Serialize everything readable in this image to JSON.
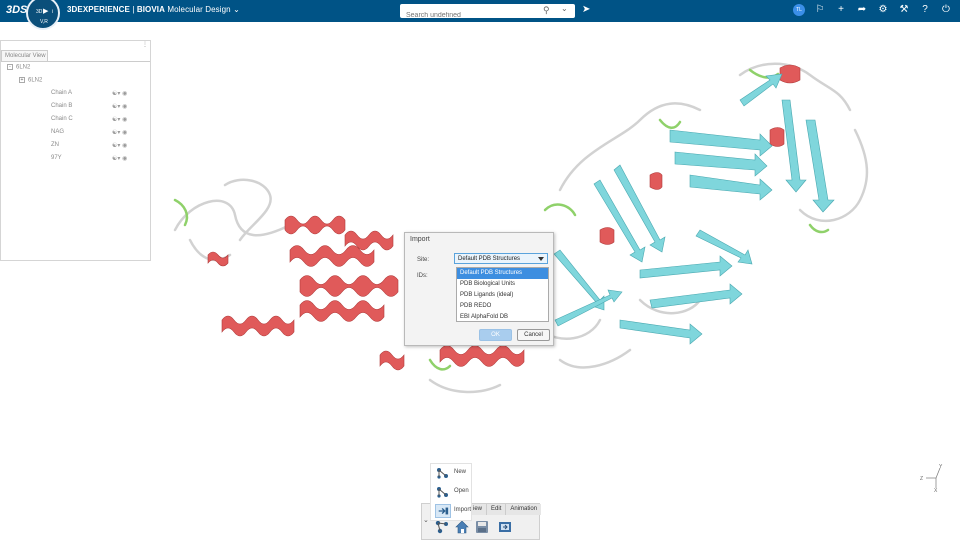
{
  "header": {
    "logo": "3DS",
    "compass": {
      "n": "",
      "left": "3D",
      "right": "i",
      "bottom": "V,R"
    },
    "brand": "3DEXPERIENCE",
    "separator": " | ",
    "product": "BIOVIA",
    "app_name": "Molecular Design",
    "search_placeholder": "Search undefined",
    "user_initials": "TL"
  },
  "molecular_view": {
    "tab_label": "Molecular View",
    "tree": [
      {
        "label": "6LN2",
        "level": 0,
        "expander": "-"
      },
      {
        "label": "6LN2",
        "level": 1,
        "expander": "+"
      },
      {
        "label": "Chain A",
        "level": 2
      },
      {
        "label": "Chain B",
        "level": 2
      },
      {
        "label": "Chain C",
        "level": 2
      },
      {
        "label": "NAG",
        "level": 2
      },
      {
        "label": "ZN",
        "level": 2
      },
      {
        "label": "97Y",
        "level": 2
      }
    ]
  },
  "import_dialog": {
    "title": "Import",
    "site_label": "Site:",
    "ids_label": "IDs:",
    "site_value": "Default PDB Structures",
    "options": [
      "Default PDB Structures",
      "PDB Biological Units",
      "PDB Ligands (ideal)",
      "PDB REDO",
      "EBI AlphaFold DB"
    ],
    "ok_label": "OK",
    "cancel_label": "Cancel"
  },
  "bottom_toolbar": {
    "menu_items": [
      "New",
      "Open",
      "Import"
    ],
    "tabs": [
      "iew",
      "Edit",
      "Animation"
    ],
    "collapse": "⌄"
  },
  "axis_labels": {
    "y": "Y",
    "z": "Z",
    "x": "X"
  },
  "colors": {
    "topbar": "#005386",
    "helix": "#e05a5a",
    "sheet": "#7fd6dc",
    "loop": "#d0d0d0",
    "turn": "#8fd16a",
    "selection": "#3d8ee0"
  }
}
